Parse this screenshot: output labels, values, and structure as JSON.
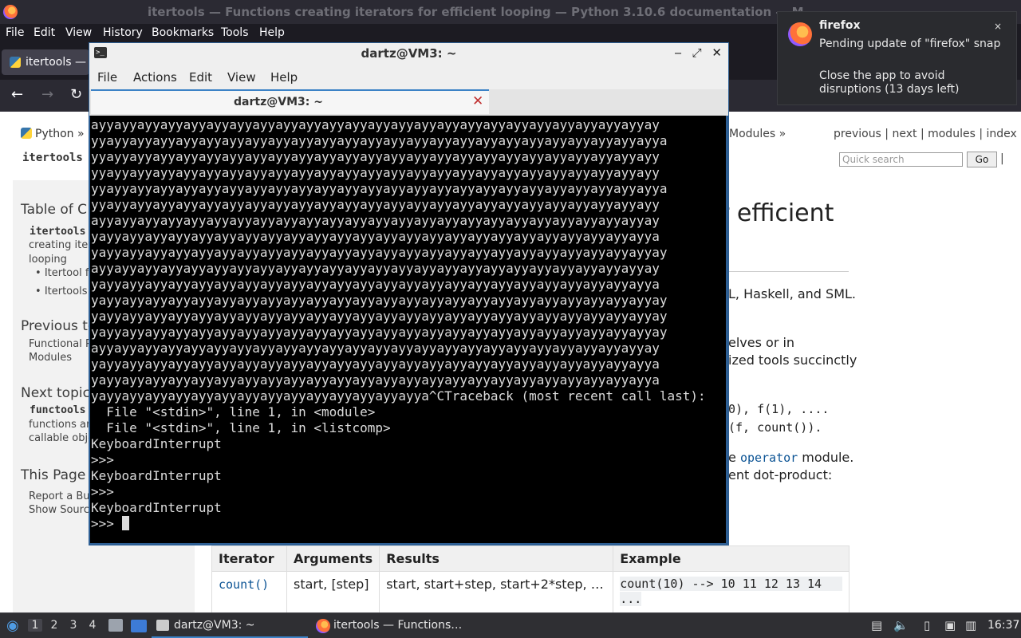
{
  "firefox": {
    "window_title": "itertools — Functions creating iterators for efficient looping — Python 3.10.6 documentation — M",
    "menu": [
      "File",
      "Edit",
      "View",
      "History",
      "Bookmarks",
      "Tools",
      "Help"
    ],
    "tab_label": "itertools — F"
  },
  "docs": {
    "breadcrumb_home": "Python »",
    "breadcrumb_module": "itertools -",
    "breadcrumb_modules": "Modules »",
    "related_nav": "previous | next | modules | index",
    "search_placeholder": "Quick search",
    "go_label": "Go",
    "go_pipe": "|",
    "sidebar": {
      "toc_heading": "Table of C",
      "toc_code": "itertools",
      "toc_line1": "creating itera",
      "toc_line2": "looping",
      "toc_item1": "Itertool fu",
      "toc_item2": "Itertools R",
      "prev_heading": "Previous to",
      "prev_line1": "Functional P",
      "prev_line2": "Modules",
      "next_heading": "Next topic",
      "next_code": "functools",
      "next_line1": "functions and",
      "next_line2": "callable obje",
      "page_heading": "This Page",
      "page_line1": "Report a Bug",
      "page_line2": "Show Source"
    },
    "main": {
      "title_fragment": "r efficient",
      "para1": "L, Haskell, and SML.",
      "para2a": "elves or in",
      "para2b": "ized tools succinctly",
      "code1": "0), f(1), ....",
      "code2": "(f, count()).",
      "para3a": "e",
      "operator_link": "operator",
      "para3b": "module.",
      "para3c": "ent dot-product:"
    },
    "table": {
      "headers": [
        "Iterator",
        "Arguments",
        "Results",
        "Example"
      ],
      "row": {
        "iterator": "count()",
        "arguments": "start, [step]",
        "results": "start, start+step, start+2*step, …",
        "example_line1": "count(10) --> 10 11 12 13 14",
        "example_line2": "..."
      }
    }
  },
  "terminal": {
    "title": "dartz@VM3: ~",
    "controls": [
      "‒",
      "⤢",
      "✕"
    ],
    "menu": [
      "File",
      "Actions",
      "Edit",
      "View",
      "Help"
    ],
    "tab_label": "dartz@VM3: ~",
    "output": "ayyayyayyayyayyayyayyayyayyayyayyayyayyayyayyayyayyayyayyayyayyayyayyayyay\nyyayyayyayyayyayyayyayyayyayyayyayyayyayyayyayyayyayyayyayyayyayyayyayyayya\nyyayyayyayyayyayyayyayyayyayyayyayyayyayyayyayyayyayyayyayyayyayyayyayyayy\nyyayyayyayyayyayyayyayyayyayyayyayyayyayyayyayyayyayyayyayyayyayyayyayyayy\nyyayyayyayyayyayyayyayyayyayyayyayyayyayyayyayyayyayyayyayyayyayyayyayyayya\nyyayyayyayyayyayyayyayyayyayyayyayyayyayyayyayyayyayyayyayyayyayyayyayyayy\nayyayyayyayyayyayyayyayyayyayyayyayyayyayyayyayyayyayyayyayyayyayyayyayyay\nyayyayyayyayyayyayyayyayyayyayyayyayyayyayyayyayyayyayyayyayyayyayyayyayya\nyayyayyayyayyayyayyayyayyayyayyayyayyayyayyayyayyayyayyayyayyayyayyayyayyay\nayyayyayyayyayyayyayyayyayyayyayyayyayyayyayyayyayyayyayyayyayyayyayyayyay\nyayyayyayyayyayyayyayyayyayyayyayyayyayyayyayyayyayyayyayyayyayyayyayyayya\nyayyayyayyayyayyayyayyayyayyayyayyayyayyayyayyayyayyayyayyayyayyayyayyayyay\nyayyayyayyayyayyayyayyayyayyayyayyayyayyayyayyayyayyayyayyayyayyayyayyayyay\nyayyayyayyayyayyayyayyayyayyayyayyayyayyayyayyayyayyayyayyayyayyayyayyayyay\nayyayyayyayyayyayyayyayyayyayyayyayyayyayyayyayyayyayyayyayyayyayyayyayyay\nyayyayyayyayyayyayyayyayyayyayyayyayyayyayyayyayyayyayyayyayyayyayyayyayya\nyayyayyayyayyayyayyayyayyayyayyayyayyayyayyayyayyayyayyayyayyayyayyayyayya\nyayyayyayyayyayyayyayyayyayyayyayyayyayyayya^CTraceback (most recent call last):\n  File \"<stdin>\", line 1, in <module>\n  File \"<stdin>\", line 1, in <listcomp>\nKeyboardInterrupt\n>>>\nKeyboardInterrupt\n>>>\nKeyboardInterrupt\n>>> "
  },
  "notification": {
    "app": "firefox",
    "summary": "Pending update of \"firefox\" snap",
    "body": "Close the app to avoid disruptions (13 days left)",
    "close": "×"
  },
  "taskbar": {
    "workspaces": [
      "1",
      "2",
      "3",
      "4"
    ],
    "task_terminal": "dartz@VM3: ~",
    "task_firefox": "itertools — Functions…",
    "clock": "16:37"
  }
}
